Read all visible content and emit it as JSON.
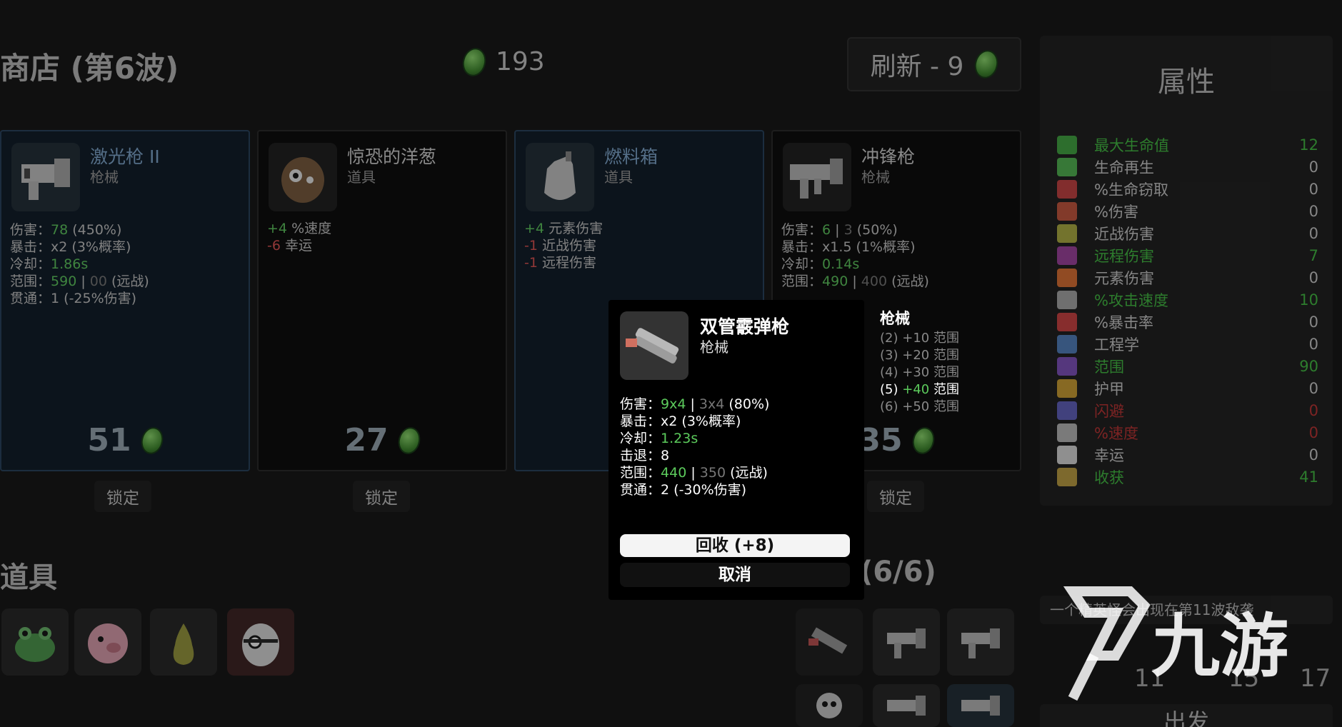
{
  "header": {
    "shop_title": "商店 (第6波)",
    "currency": "193",
    "refresh_label": "刷新 - 9"
  },
  "shop_cards": [
    {
      "name": "激光枪 II",
      "type": "枪械",
      "price": "51",
      "lock": "锁定",
      "stats": [
        {
          "label": "伤害：",
          "v1": "78",
          "v2": "",
          "extra": "(450%)"
        },
        {
          "label": "暴击：",
          "v1": "x2",
          "extra": "(3%概率)"
        },
        {
          "label": "冷却：",
          "v1": "1.86s"
        },
        {
          "label": "范围：",
          "v1": "590",
          "v2": "00",
          "extra": "(远战)"
        },
        {
          "label": "贯通：",
          "v1": "1",
          "extra": "(-25%伤害)"
        }
      ]
    },
    {
      "name": "惊恐的洋葱",
      "type": "道具",
      "price": "27",
      "lock": "锁定",
      "stats": [
        {
          "sign": "+4",
          "label": "%速度"
        },
        {
          "sign": "-6",
          "label": "幸运"
        }
      ]
    },
    {
      "name": "燃料箱",
      "type": "道具",
      "price": "",
      "stats": [
        {
          "sign": "+4",
          "label": "元素伤害"
        },
        {
          "sign": "-1",
          "label": "近战伤害"
        },
        {
          "sign": "-1",
          "label": "远程伤害"
        }
      ]
    },
    {
      "name": "冲锋枪",
      "type": "枪械",
      "price": "35",
      "lock": "锁定",
      "stats": [
        {
          "label": "伤害：",
          "v1": "6",
          "v2": "3",
          "extra": "(50%)"
        },
        {
          "label": "暴击：",
          "v1": "x1.5",
          "extra": "(1%概率)"
        },
        {
          "label": "冷却：",
          "v1": "0.14s"
        },
        {
          "label": "范围：",
          "v1": "490",
          "v2": "400",
          "extra": "(远战)"
        }
      ]
    }
  ],
  "items_label": "道具",
  "weapons_label": "(6/6)",
  "attributes": {
    "title": "属性",
    "rows": [
      {
        "name": "最大生命值",
        "value": "12",
        "state": "pos",
        "color": "#3fa83f"
      },
      {
        "name": "生命再生",
        "value": "0",
        "state": "neutral",
        "color": "#4fb84f"
      },
      {
        "name": "%生命窃取",
        "value": "0",
        "state": "neutral",
        "color": "#c94040"
      },
      {
        "name": "%伤害",
        "value": "0",
        "state": "neutral",
        "color": "#c9553a"
      },
      {
        "name": "近战伤害",
        "value": "0",
        "state": "neutral",
        "color": "#b0b040"
      },
      {
        "name": "远程伤害",
        "value": "7",
        "state": "pos",
        "color": "#a040a0"
      },
      {
        "name": "元素伤害",
        "value": "0",
        "state": "neutral",
        "color": "#e07030"
      },
      {
        "name": "%攻击速度",
        "value": "10",
        "state": "pos",
        "color": "#aaaaaa"
      },
      {
        "name": "%暴击率",
        "value": "0",
        "state": "neutral",
        "color": "#d04040"
      },
      {
        "name": "工程学",
        "value": "0",
        "state": "neutral",
        "color": "#5080c0"
      },
      {
        "name": "范围",
        "value": "90",
        "state": "pos",
        "color": "#8050c0"
      },
      {
        "name": "护甲",
        "value": "0",
        "state": "neutral",
        "color": "#d0a030"
      },
      {
        "name": "闪避",
        "value": "0",
        "state": "neg",
        "color": "#6060c0"
      },
      {
        "name": "%速度",
        "value": "0",
        "state": "neg",
        "color": "#bbbbbb"
      },
      {
        "name": "幸运",
        "value": "0",
        "state": "neutral",
        "color": "#dddddd"
      },
      {
        "name": "收获",
        "value": "41",
        "state": "pos",
        "color": "#c0a040"
      }
    ]
  },
  "notice": "一个精英怪会出现在第11波敌袭",
  "depart": "出发",
  "inventory_counts": [
    "11",
    "15",
    "17"
  ],
  "popup": {
    "name": "双管霰弹枪",
    "type": "枪械",
    "stats": [
      {
        "label": "伤害：",
        "v1": "9x4",
        "v2": "3x4",
        "extra": "(80%)"
      },
      {
        "label": "暴击：",
        "v1": "x2",
        "extra": "(3%概率)"
      },
      {
        "label": "冷却：",
        "v1": "1.23s"
      },
      {
        "label": "击退：",
        "v1": "8"
      },
      {
        "label": "范围：",
        "v1": "440",
        "v2": "350",
        "extra": "(远战)"
      },
      {
        "label": "贯通：",
        "v1": "2",
        "extra": "(-30%伤害)"
      }
    ],
    "recycle": "回收 (+8)",
    "cancel": "取消",
    "set": {
      "title": "枪械",
      "bonuses": [
        {
          "count": "(2)",
          "value": "+10",
          "label": "范围"
        },
        {
          "count": "(3)",
          "value": "+20",
          "label": "范围"
        },
        {
          "count": "(4)",
          "value": "+30",
          "label": "范围"
        },
        {
          "count": "(5)",
          "value": "+40",
          "label": "范围",
          "active": true
        },
        {
          "count": "(6)",
          "value": "+50",
          "label": "范围"
        }
      ]
    }
  },
  "watermark": "九游"
}
